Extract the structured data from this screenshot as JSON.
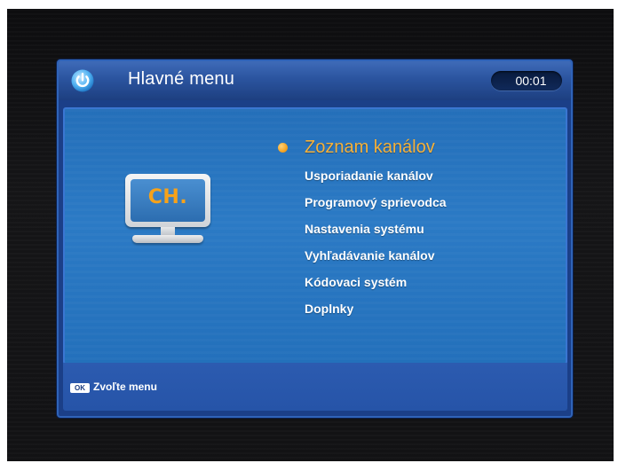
{
  "header": {
    "title": "Hlavné menu",
    "clock": "00:01",
    "icon": "power-icon"
  },
  "category_icon": {
    "name": "tv-channel-icon",
    "label": "CH."
  },
  "menu": {
    "items": [
      {
        "label": "Zoznam kanálov",
        "selected": true
      },
      {
        "label": "Usporiadanie kanálov",
        "selected": false
      },
      {
        "label": "Programový sprievodca",
        "selected": false
      },
      {
        "label": "Nastavenia systému",
        "selected": false
      },
      {
        "label": "Vyhľadávanie kanálov",
        "selected": false
      },
      {
        "label": "Kódovaci systém",
        "selected": false
      },
      {
        "label": "Doplnky",
        "selected": false
      }
    ]
  },
  "footer": {
    "ok_label": "OK",
    "hint": "Zvoľte menu"
  },
  "colors": {
    "accent": "#f6a21a",
    "panel": "#1b3f88",
    "body": "#2773bd"
  }
}
